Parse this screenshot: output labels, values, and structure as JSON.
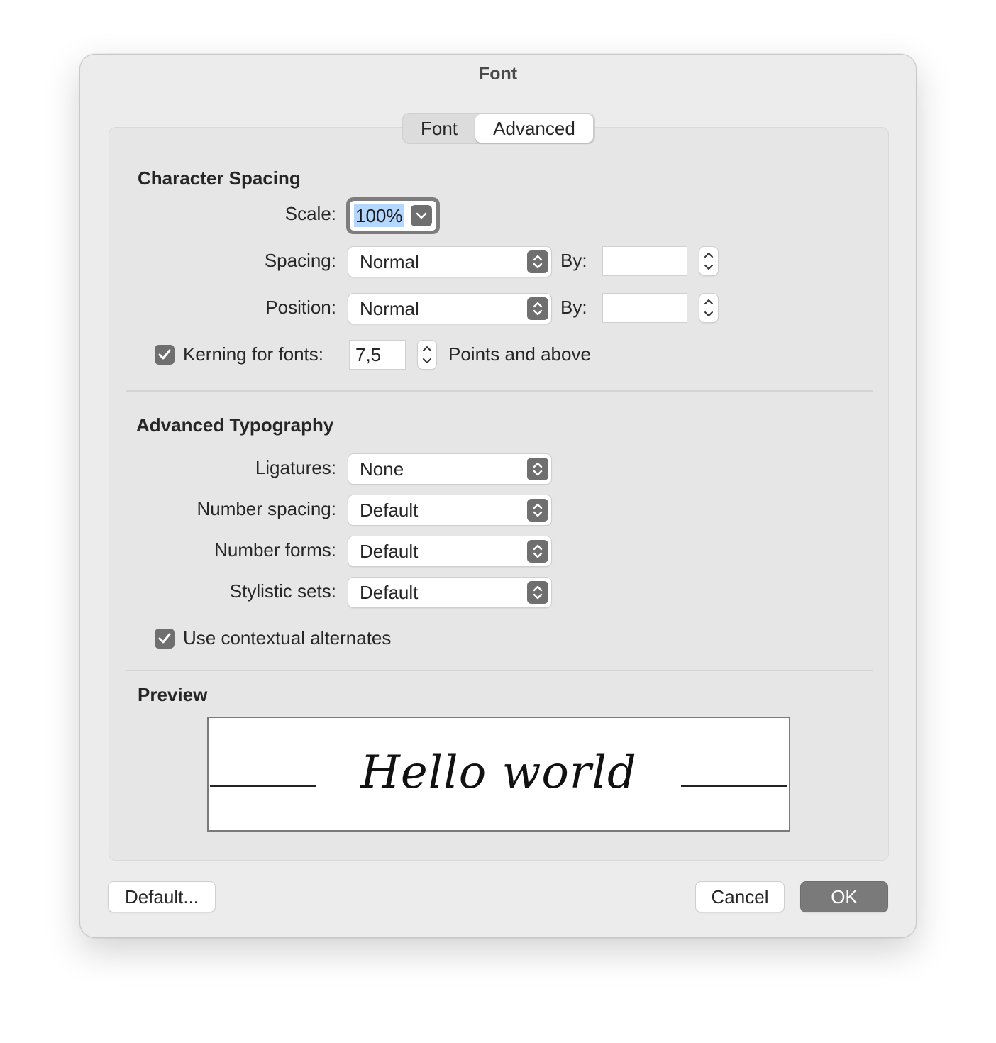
{
  "window": {
    "title": "Font"
  },
  "tabs": [
    {
      "label": "Font",
      "selected": false
    },
    {
      "label": "Advanced",
      "selected": true
    }
  ],
  "character_spacing": {
    "title": "Character Spacing",
    "scale": {
      "label": "Scale:",
      "value": "100%"
    },
    "spacing": {
      "label": "Spacing:",
      "value": "Normal",
      "by_label": "By:",
      "by_value": ""
    },
    "position": {
      "label": "Position:",
      "value": "Normal",
      "by_label": "By:",
      "by_value": ""
    },
    "kerning": {
      "label": "Kerning for fonts:",
      "checked": true,
      "value": "7,5",
      "suffix": "Points and above"
    }
  },
  "advanced_typography": {
    "title": "Advanced Typography",
    "ligatures": {
      "label": "Ligatures:",
      "value": "None"
    },
    "number_spacing": {
      "label": "Number spacing:",
      "value": "Default"
    },
    "number_forms": {
      "label": "Number forms:",
      "value": "Default"
    },
    "stylistic_sets": {
      "label": "Stylistic sets:",
      "value": "Default"
    },
    "contextual_alternates": {
      "label": "Use contextual alternates",
      "checked": true
    }
  },
  "preview": {
    "title": "Preview",
    "text": "Hello world"
  },
  "buttons": {
    "default": "Default...",
    "cancel": "Cancel",
    "ok": "OK"
  },
  "colors": {
    "accent_gray": "#6f6f6f",
    "selection": "#b3d7ff",
    "panel": "#e6e6e6"
  }
}
